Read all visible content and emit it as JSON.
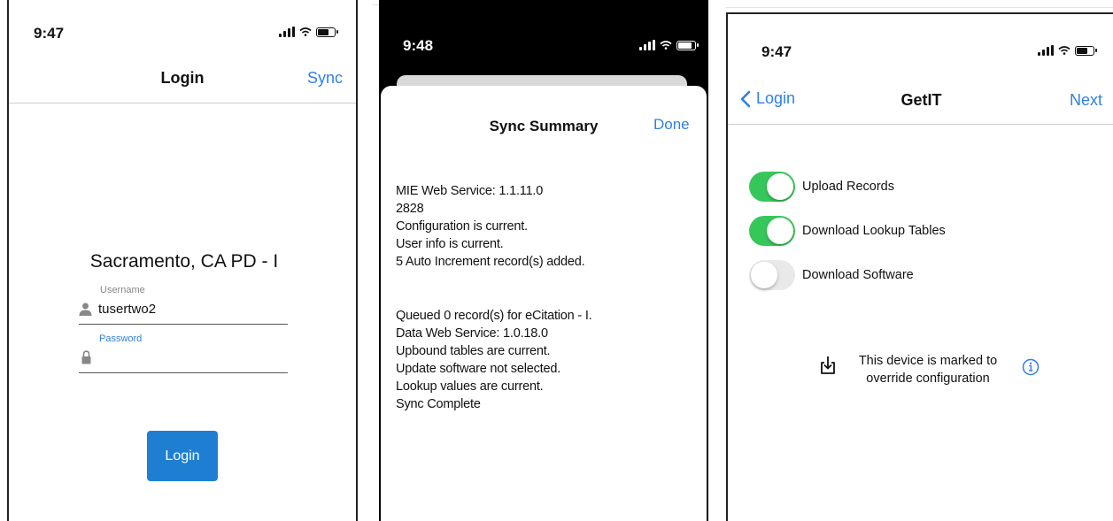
{
  "login_screen": {
    "status_time": "9:47",
    "nav_title": "Login",
    "sync_label": "Sync",
    "agency_name": "Sacramento, CA PD - I",
    "username_label": "Username",
    "username_value": "tusertwo2",
    "password_label": "Password",
    "login_button": "Login",
    "icons": [
      "person-icon",
      "lock-icon"
    ],
    "accent_color": "#2f7fe6",
    "button_color": "#1e7fd2"
  },
  "sync_summary_screen": {
    "status_time": "9:48",
    "title": "Sync Summary",
    "done_label": "Done",
    "lines_group1": [
      "MIE Web Service: 1.1.11.0",
      "2828",
      "Configuration is current.",
      "User info is current.",
      "5 Auto Increment record(s) added."
    ],
    "lines_group2": [
      "Queued 0 record(s) for eCitation - I.",
      "Data Web Service: 1.0.18.0",
      "Upbound tables are current.",
      "Update software not selected.",
      "Lookup values are current.",
      "Sync Complete"
    ]
  },
  "getit_screen": {
    "status_time": "9:47",
    "back_label": "Login",
    "title": "GetIT",
    "next_label": "Next",
    "toggles": [
      {
        "label": "Upload Records",
        "on": true
      },
      {
        "label": "Download Lookup Tables",
        "on": true
      },
      {
        "label": "Download Software",
        "on": false
      }
    ],
    "notice_line1": "This device is marked to",
    "notice_line2": "override configuration",
    "icons": [
      "download-icon",
      "info-icon",
      "chevron-left-icon"
    ],
    "toggle_on_color": "#36c75a"
  }
}
